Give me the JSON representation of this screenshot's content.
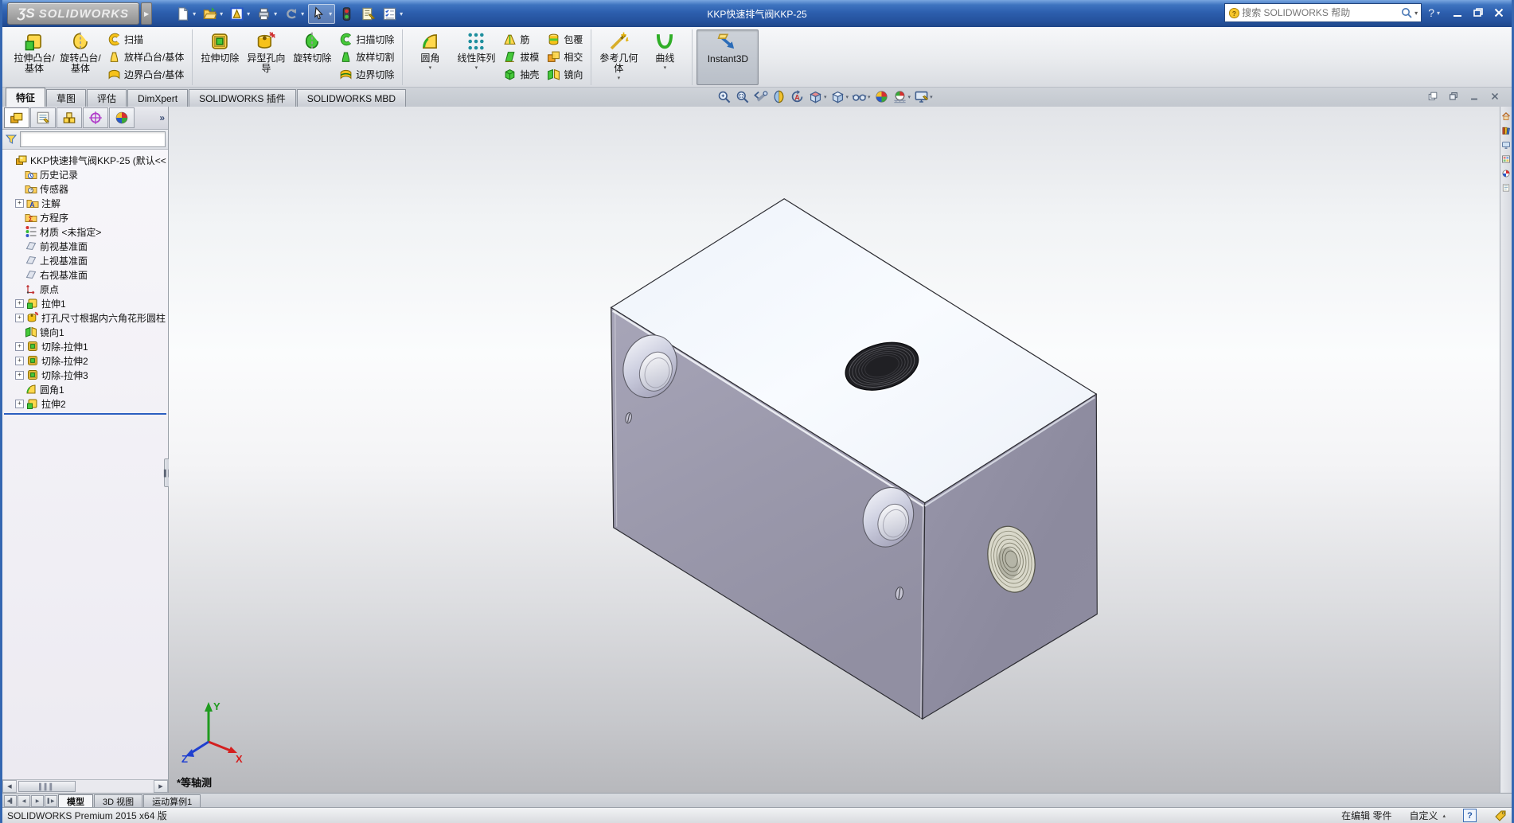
{
  "colors": {
    "titlebar_blue": "#2d5fae",
    "model_top": "#f4f8fd",
    "model_left": "#9d9bae",
    "model_right": "#8d8b9f",
    "rollback_blue": "#2b5fc0"
  },
  "title_bar": {
    "logo_mark": "ƷS",
    "logo_text": "SOLIDWORKS",
    "document_title": "KKP快速排气阀KKP-25",
    "search": {
      "placeholder": "搜索 SOLIDWORKS 帮助"
    },
    "help_label": "?",
    "tools": [
      {
        "name": "new-document",
        "dropdown": true
      },
      {
        "name": "open",
        "dropdown": true
      },
      {
        "name": "make-drawing",
        "dropdown": true
      },
      {
        "name": "print",
        "dropdown": true
      },
      {
        "name": "undo",
        "dropdown": true
      },
      {
        "name": "select",
        "dropdown": true,
        "active": true
      },
      {
        "name": "rebuild"
      },
      {
        "name": "file-properties"
      },
      {
        "name": "options",
        "dropdown": true
      }
    ],
    "window_controls": [
      "minimize",
      "restore",
      "close"
    ]
  },
  "ribbon": {
    "groups": [
      {
        "big": [
          {
            "label": "拉伸凸台/基体",
            "icon": "boss-extrude"
          },
          {
            "label": "旋转凸台/基体",
            "icon": "revolve-boss"
          }
        ],
        "smalls": [
          [
            {
              "label": "扫描",
              "icon": "sweep"
            },
            {
              "label": "放样凸台/基体",
              "icon": "loft"
            },
            {
              "label": "边界凸台/基体",
              "icon": "boundary"
            }
          ]
        ]
      },
      {
        "big": [
          {
            "label": "拉伸切除",
            "icon": "cut-extrude"
          },
          {
            "label": "异型孔向导",
            "icon": "hole-wizard"
          },
          {
            "label": "旋转切除",
            "icon": "revolve-cut"
          }
        ],
        "smalls": [
          [
            {
              "label": "扫描切除",
              "icon": "sweep-cut"
            },
            {
              "label": "放样切割",
              "icon": "loft-cut"
            },
            {
              "label": "边界切除",
              "icon": "boundary-cut"
            }
          ]
        ]
      },
      {
        "big": [
          {
            "label": "圆角",
            "icon": "fillet",
            "dropdown": true
          },
          {
            "label": "线性阵列",
            "icon": "pattern",
            "dropdown": true
          }
        ],
        "smalls": [
          [
            {
              "label": "筋",
              "icon": "rib"
            },
            {
              "label": "拔模",
              "icon": "draft"
            },
            {
              "label": "抽壳",
              "icon": "shell"
            }
          ],
          [
            {
              "label": "包覆",
              "icon": "wrap"
            },
            {
              "label": "相交",
              "icon": "intersect"
            },
            {
              "label": "镜向",
              "icon": "mirror"
            }
          ]
        ]
      },
      {
        "big": [
          {
            "label": "参考几何体",
            "icon": "refgeom",
            "dropdown": true
          },
          {
            "label": "曲线",
            "icon": "curves",
            "dropdown": true
          }
        ]
      },
      {
        "big": [
          {
            "label": "Instant3D",
            "icon": "instant3d",
            "active": true
          }
        ]
      }
    ],
    "tabs": [
      {
        "label": "特征",
        "active": true
      },
      {
        "label": "草图"
      },
      {
        "label": "评估"
      },
      {
        "label": "DimXpert"
      },
      {
        "label": "SOLIDWORKS 插件"
      },
      {
        "label": "SOLIDWORKS MBD"
      }
    ]
  },
  "feature_tree": {
    "panel_tabs": [
      "featuremanager",
      "propertymanager",
      "configurationmanager",
      "dimxpertmanager",
      "displaymanager"
    ],
    "more_label": "»",
    "root_label": "KKP快速排气阀KKP-25 (默认<<",
    "items": [
      {
        "label": "历史记录",
        "icon": "history-folder"
      },
      {
        "label": "传感器",
        "icon": "sensors-folder"
      },
      {
        "label": "注解",
        "icon": "annotations-folder",
        "plus": true
      },
      {
        "label": "方程序",
        "icon": "equations-folder"
      },
      {
        "label": "材质 <未指定>",
        "icon": "material"
      },
      {
        "label": "前视基准面",
        "icon": "plane"
      },
      {
        "label": "上视基准面",
        "icon": "plane"
      },
      {
        "label": "右视基准面",
        "icon": "plane"
      },
      {
        "label": "原点",
        "icon": "origin"
      },
      {
        "label": "拉伸1",
        "icon": "boss-extrude",
        "plus": true
      },
      {
        "label": "打孔尺寸根据内六角花形圆柱",
        "icon": "hole-wizard",
        "plus": true
      },
      {
        "label": "镜向1",
        "icon": "mirror"
      },
      {
        "label": "切除-拉伸1",
        "icon": "cut-extrude",
        "plus": true
      },
      {
        "label": "切除-拉伸2",
        "icon": "cut-extrude",
        "plus": true
      },
      {
        "label": "切除-拉伸3",
        "icon": "cut-extrude",
        "plus": true
      },
      {
        "label": "圆角1",
        "icon": "fillet"
      },
      {
        "label": "拉伸2",
        "icon": "boss-extrude",
        "plus": true
      }
    ]
  },
  "viewport": {
    "view_label": "*等轴测",
    "triad": {
      "x": "X",
      "y": "Y",
      "z": "Z"
    },
    "headsup": [
      {
        "name": "zoom-fit"
      },
      {
        "name": "zoom-area"
      },
      {
        "name": "previous-view"
      },
      {
        "name": "section-view"
      },
      {
        "name": "rotate-view"
      },
      {
        "name": "view-orientation",
        "dropdown": true
      },
      {
        "name": "display-style",
        "dropdown": true
      },
      {
        "name": "hide-show-items",
        "dropdown": true
      },
      {
        "name": "edit-appearance"
      },
      {
        "name": "apply-scene",
        "dropdown": true
      },
      {
        "name": "view-settings",
        "dropdown": true
      }
    ],
    "doc_window_controls": [
      "cascade",
      "restore",
      "minimize",
      "close"
    ]
  },
  "task_pane": {
    "icons": [
      "resources",
      "design-library",
      "file-explorer",
      "view-palette",
      "appearances",
      "custom-properties"
    ]
  },
  "document_tabs": {
    "nav": [
      "first",
      "prev",
      "next",
      "last"
    ],
    "tabs": [
      {
        "label": "模型",
        "active": true
      },
      {
        "label": "3D 视图"
      },
      {
        "label": "运动算例1"
      }
    ]
  },
  "status_bar": {
    "left_text": "SOLIDWORKS Premium 2015 x64 版",
    "editing_text": "在编辑 零件",
    "units_text": "自定义",
    "icons": [
      "help-box",
      "tag"
    ]
  }
}
